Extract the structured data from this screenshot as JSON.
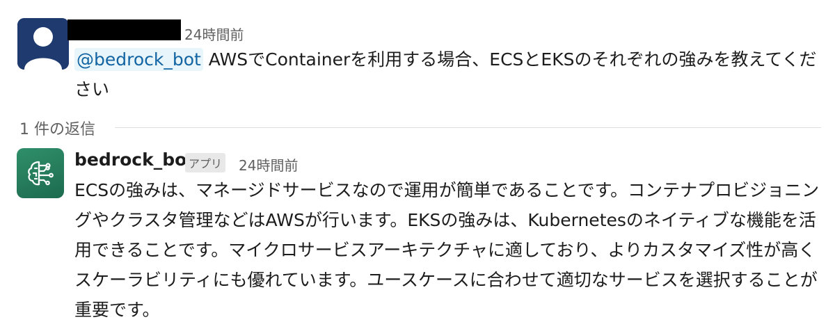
{
  "thread": {
    "parent": {
      "author_avatar_icon": "user-silhouette-icon",
      "timestamp": "24時間前",
      "mention": "@bedrock_bot",
      "text": " AWSでContainerを利用する場合、ECSとEKSのそれぞれの強みを教えてください"
    },
    "reply_count_label": "1 件の返信",
    "reply": {
      "author_avatar_icon": "ai-circuit-brain-icon",
      "author": "bedrock_bot",
      "badge": "アプリ",
      "timestamp": "24時間前",
      "text": "ECSの強みは、マネージドサービスなので運用が簡単であることです。コンテナプロビジョニングやクラスタ管理などはAWSが行います。EKSの強みは、Kubernetesのネイティブな機能を活用できることです。マイクロサービスアーキテクチャに適しており、よりカスタマイズ性が高くスケーラビリティにも優れています。ユースケースに合わせて適切なサービスを選択することが重要です。"
    }
  },
  "colors": {
    "mention_text": "#1264a3",
    "mention_bg": "#e8f5fa",
    "user_avatar_bg": "#1e3a6e",
    "bot_avatar_bg": "#2f8f6a"
  }
}
